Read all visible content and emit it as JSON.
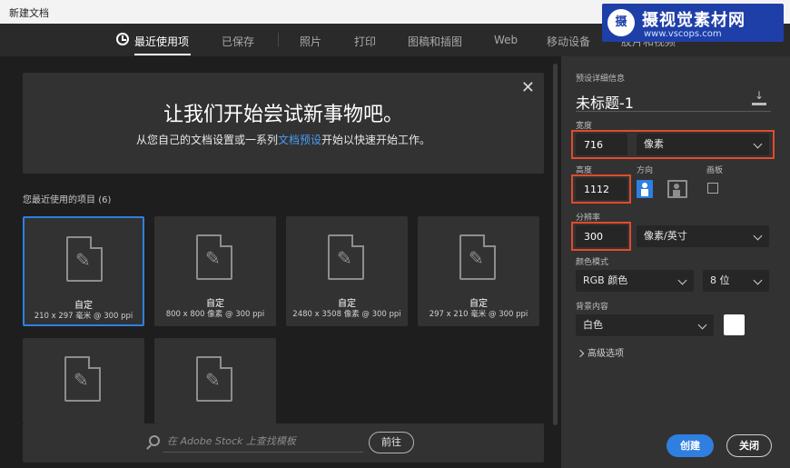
{
  "window": {
    "title": "新建文档"
  },
  "tabs": [
    "最近使用项",
    "已保存",
    "照片",
    "打印",
    "图稿和插图",
    "Web",
    "移动设备",
    "胶片和视频"
  ],
  "watermark": {
    "logo": "摄",
    "title": "摄视觉素材网",
    "url": "www.vscops.com"
  },
  "hero": {
    "heading": "让我们开始尝试新事物吧。",
    "sub_before": "从您自己的文档设置或一系列",
    "sub_link": "文档预设",
    "sub_after": "开始以快速开始工作。"
  },
  "recent": {
    "label": "您最近使用的项目",
    "count": "(6)",
    "items": [
      {
        "name": "自定",
        "size": "210 x 297 毫米 @ 300 ppi"
      },
      {
        "name": "自定",
        "size": "800 x 800 像素 @ 300 ppi"
      },
      {
        "name": "自定",
        "size": "2480 x 3508 像素 @ 300 ppi"
      },
      {
        "name": "自定",
        "size": "297 x 210 毫米 @ 300 ppi"
      },
      {
        "name": "",
        "size": ""
      },
      {
        "name": "",
        "size": ""
      }
    ]
  },
  "search": {
    "placeholder": "在 Adobe Stock 上查找模板",
    "go_label": "前往"
  },
  "details": {
    "section_label": "预设详细信息",
    "doc_name": "未标题-1",
    "width_label": "宽度",
    "width_value": "716",
    "width_unit": "像素",
    "height_label": "高度",
    "height_value": "1112",
    "orientation_label": "方向",
    "artboard_label": "画板",
    "resolution_label": "分辨率",
    "resolution_value": "300",
    "resolution_unit": "像素/英寸",
    "color_mode_label": "颜色模式",
    "color_mode": "RGB 颜色",
    "bit_depth": "8 位",
    "bg_label": "背景内容",
    "bg_value": "白色",
    "bg_color": "#ffffff",
    "advanced_label": "高级选项"
  },
  "buttons": {
    "create": "创建",
    "close": "关闭"
  },
  "colors": {
    "accent": "#2f7fe0",
    "highlight": "#e24a2d"
  }
}
